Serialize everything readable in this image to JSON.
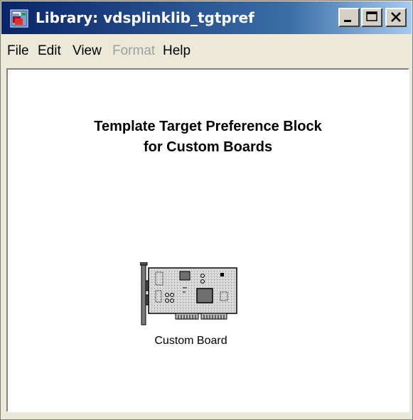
{
  "window": {
    "title": "Library: vdsplinklib_tgtpref",
    "controls": [
      "minimize-icon",
      "maximize-icon",
      "close-icon"
    ]
  },
  "menu": {
    "file": "File",
    "edit": "Edit",
    "view": "View",
    "format": "Format",
    "help": "Help"
  },
  "canvas": {
    "heading_line1": "Template Target Preference Block",
    "heading_line2": "for Custom  Boards",
    "block": {
      "label": "Custom Board",
      "icon": "circuit-board-icon"
    }
  }
}
